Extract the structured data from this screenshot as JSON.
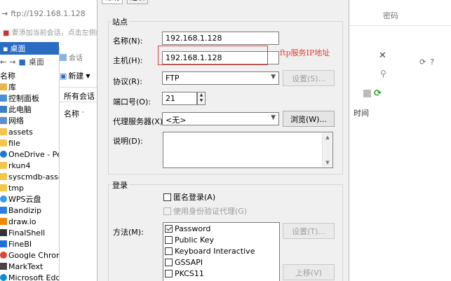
{
  "background_left": {
    "address": "ftp://192.168.1.128",
    "bookmark_hint": "要添加当前会话，点击左侧的",
    "explorer_title": "桌面",
    "nav_location": "桌面",
    "tree_header": "名称",
    "tree_items": [
      "库",
      "控制面板",
      "此电脑",
      "网络",
      "assets",
      "file",
      "OneDrive - Perso",
      "rkun4",
      "syscmdb-assets",
      "tmp",
      "WPS云盘",
      "Bandizip",
      "draw.io",
      "FinalShell",
      "FineBI",
      "Google Chrome",
      "MarkText",
      "Microsoft Edge"
    ]
  },
  "background_session": {
    "title": "会话",
    "new_button": "新建",
    "all_sessions": "所有会话",
    "name_header": "名称"
  },
  "background_right": {
    "password_label": "密码",
    "time_header": "时间"
  },
  "dialog": {
    "tabs": [
      "常规",
      "选项"
    ],
    "site_group": {
      "title": "站点",
      "name_label": "名称(N):",
      "name_value": "192.168.1.128",
      "host_label": "主机(H):",
      "host_value": "192.168.1.128",
      "protocol_label": "协议(R):",
      "protocol_value": "FTP",
      "settings_button": "设置(S)...",
      "port_label": "端口号(O):",
      "port_value": "21",
      "proxy_label": "代理服务器(X):",
      "proxy_value": "<无>",
      "browse_button": "浏览(W)...",
      "description_label": "说明(D):"
    },
    "login_group": {
      "title": "登录",
      "anonymous_label": "匿名登录(A)",
      "anonymous_checked": false,
      "auth_agent_label": "使用身份验证代理(G)",
      "method_label": "方法(M):",
      "methods": [
        {
          "label": "Password",
          "checked": true
        },
        {
          "label": "Public Key",
          "checked": false
        },
        {
          "label": "Keyboard Interactive",
          "checked": false
        },
        {
          "label": "GSSAPI",
          "checked": false
        },
        {
          "label": "PKCS11",
          "checked": false
        }
      ],
      "settings_button": "设置(T)...",
      "move_up_button": "上移(V)"
    }
  },
  "annotation": {
    "text": "ftp服务IP地址",
    "color": "#e53935"
  }
}
